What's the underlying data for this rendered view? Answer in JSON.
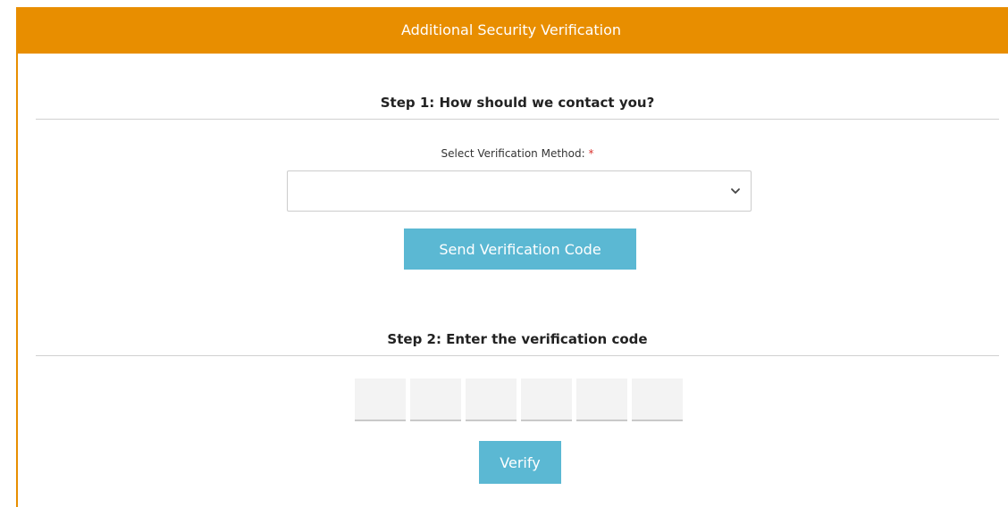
{
  "header": {
    "title": "Additional Security Verification"
  },
  "step1": {
    "title": "Step 1: How should we contact you?",
    "method_label": "Select Verification Method:",
    "required_mark": "*",
    "method_value": "",
    "send_button_label": "Send Verification Code"
  },
  "step2": {
    "title": "Step 2: Enter the verification code",
    "code_digits": [
      "",
      "",
      "",
      "",
      "",
      ""
    ],
    "verify_button_label": "Verify"
  },
  "colors": {
    "header_bg": "#e88e00",
    "button_bg": "#5bb8d3",
    "required": "#d9332f"
  },
  "icons": {
    "select_dropdown": "chevron-down-icon"
  }
}
